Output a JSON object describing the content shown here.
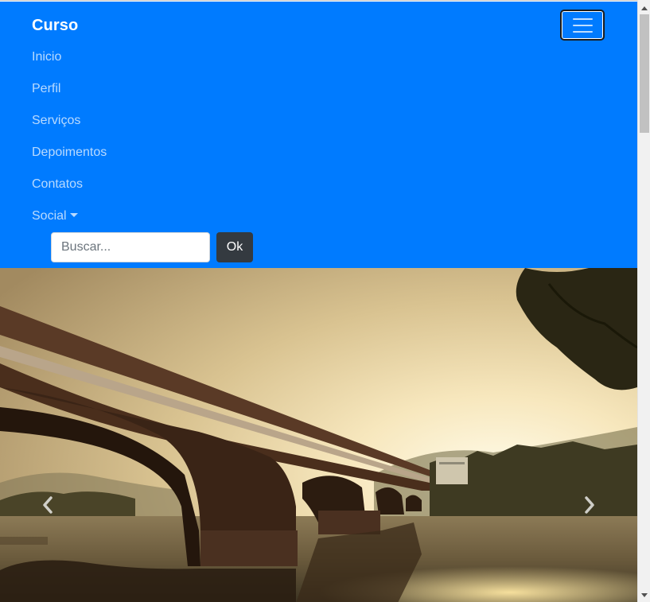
{
  "navbar": {
    "brand": "Curso",
    "background_color": "#007bff",
    "toggler_icon": "hamburger-icon",
    "items": [
      {
        "label": "Inicio"
      },
      {
        "label": "Perfil"
      },
      {
        "label": "Serviços"
      },
      {
        "label": "Depoimentos"
      },
      {
        "label": "Contatos"
      },
      {
        "label": "Social",
        "icon": "caret-down-icon"
      }
    ],
    "search": {
      "placeholder": "Buscar...",
      "value": ""
    },
    "submit_label": "Ok"
  },
  "carousel": {
    "image": "bridge-sunset-photo",
    "prev_icon": "chevron-left-icon",
    "next_icon": "chevron-right-icon"
  },
  "scrollbar": {
    "up_icon": "scroll-up-arrow-icon",
    "down_icon": "scroll-down-arrow-icon"
  }
}
